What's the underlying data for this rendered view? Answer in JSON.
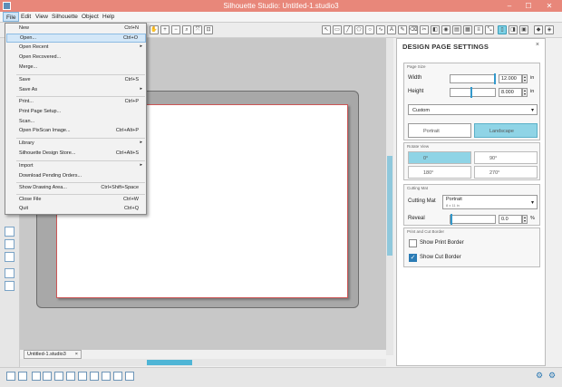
{
  "window": {
    "title": "Silhouette Studio: Untitled-1.studio3",
    "minimize": "–",
    "maximize": "☐",
    "close": "✕"
  },
  "menubar": [
    "File",
    "Edit",
    "View",
    "Silhouette",
    "Object",
    "Help"
  ],
  "file_menu": [
    {
      "label": "New",
      "shortcut": "Ctrl+N"
    },
    {
      "label": "Open...",
      "shortcut": "Ctrl+O",
      "highlighted": true
    },
    {
      "label": "Open Recent",
      "submenu": "▸"
    },
    {
      "label": "Open Recovered..."
    },
    {
      "label": "Merge..."
    },
    {
      "label": "Save",
      "shortcut": "Ctrl+S"
    },
    {
      "label": "Save As",
      "submenu": "▸"
    },
    {
      "label": "Print...",
      "shortcut": "Ctrl+P"
    },
    {
      "label": "Print Page Setup..."
    },
    {
      "label": "Scan..."
    },
    {
      "label": "Open PixScan Image...",
      "shortcut": "Ctrl+Alt+P"
    },
    {
      "label": "Library",
      "submenu": "▸"
    },
    {
      "label": "Silhouette Design Store...",
      "shortcut": "Ctrl+Alt+S"
    },
    {
      "label": "Import",
      "submenu": "▸"
    },
    {
      "label": "Download Pending Orders..."
    },
    {
      "label": "Show Drawing Area...",
      "shortcut": "Ctrl+Shift+Space"
    },
    {
      "label": "Close File",
      "shortcut": "Ctrl+W"
    },
    {
      "label": "Quit",
      "shortcut": "Ctrl+Q"
    }
  ],
  "document_tab": {
    "label": "Untitled-1.studio3",
    "close": "×"
  },
  "panel": {
    "title": "DESIGN PAGE SETTINGS",
    "close": "×",
    "page_size": {
      "section": "Page Size",
      "width_label": "Width",
      "width_value": "12.000",
      "height_label": "Height",
      "height_value": "8.000",
      "unit": "in",
      "size_preset": "Custom",
      "portrait": "Portrait",
      "landscape": "Landscape",
      "selected_orientation": "Landscape"
    },
    "rotate_view": {
      "section": "Rotate View",
      "options": [
        "0°",
        "90°",
        "180°",
        "270°"
      ],
      "selected": "0°"
    },
    "cutting_mat": {
      "section": "Cutting Mat",
      "label": "Cutting Mat",
      "value": "Portrait",
      "sub": "8 x 11 in",
      "reveal_label": "Reveal",
      "reveal_value": "0.0",
      "reveal_unit": "%"
    },
    "borders": {
      "section": "Print and Cut Border",
      "show_print_border": "Show Print Border",
      "show_print_border_checked": false,
      "show_cut_border": "Show Cut Border",
      "show_cut_border_checked": true
    }
  },
  "colors": {
    "titlebar": "#e8877a",
    "accent": "#8fd4e6",
    "highlight": "#d3e7f8"
  }
}
